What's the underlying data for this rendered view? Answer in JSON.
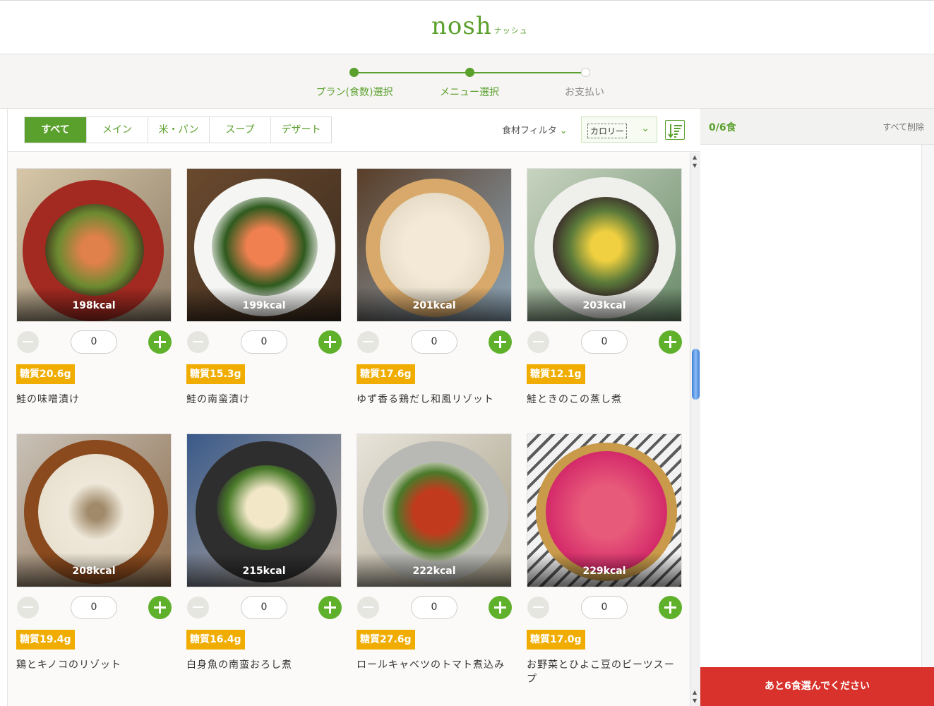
{
  "brand": {
    "logo": "nosh",
    "logo_sub": "ナッシュ"
  },
  "steps": [
    {
      "label": "プラン(食数)選択"
    },
    {
      "label": "メニュー選択"
    },
    {
      "label": "お支払い"
    }
  ],
  "tabs": [
    "すべて",
    "メイン",
    "米・パン",
    "スープ",
    "デザート"
  ],
  "filter": {
    "ingredient_label": "食材フィルタ",
    "sort_value": "カロリー"
  },
  "cart": {
    "count": "0/6食",
    "clear_label": "すべて削除",
    "cta": "あと6食選んでください"
  },
  "menu": [
    {
      "kcal": "198kcal",
      "qty": "0",
      "carb": "糖質20.6g",
      "name": "鮭の味噌漬け"
    },
    {
      "kcal": "199kcal",
      "qty": "0",
      "carb": "糖質15.3g",
      "name": "鮭の南蛮漬け"
    },
    {
      "kcal": "201kcal",
      "qty": "0",
      "carb": "糖質17.6g",
      "name": "ゆず香る鶏だし和風リゾット"
    },
    {
      "kcal": "203kcal",
      "qty": "0",
      "carb": "糖質12.1g",
      "name": "鮭ときのこの蒸し煮"
    },
    {
      "kcal": "208kcal",
      "qty": "0",
      "carb": "糖質19.4g",
      "name": "鶏とキノコのリゾット"
    },
    {
      "kcal": "215kcal",
      "qty": "0",
      "carb": "糖質16.4g",
      "name": "白身魚の南蛮おろし煮"
    },
    {
      "kcal": "222kcal",
      "qty": "0",
      "carb": "糖質27.6g",
      "name": "ロールキャベツのトマト煮込み"
    },
    {
      "kcal": "229kcal",
      "qty": "0",
      "carb": "糖質17.0g",
      "name": "お野菜とひよこ豆のビーツスープ"
    }
  ],
  "icons": {
    "minus": "minus-circle-icon",
    "plus": "plus-circle-icon",
    "sort": "sort-descending-icon",
    "chevron": "chevron-down-icon"
  },
  "colors": {
    "brand_green": "#5aa02c",
    "carb_badge": "#f0ad00",
    "cta_red": "#d9312b"
  }
}
